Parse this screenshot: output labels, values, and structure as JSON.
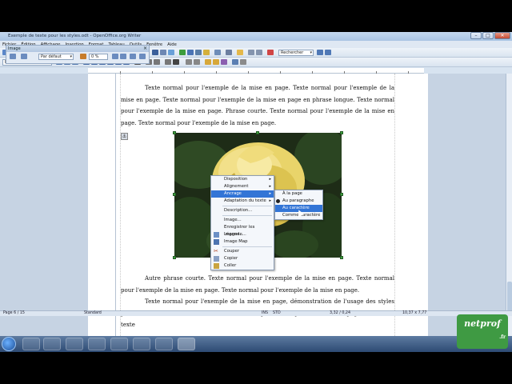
{
  "window": {
    "title": "Exemple de texte pour les styles.odt - OpenOffice.org Writer"
  },
  "menu": {
    "items": [
      "Fichier",
      "Édition",
      "Affichage",
      "Insertion",
      "Format",
      "Tableau",
      "Outils",
      "Fenêtre",
      "Aide"
    ]
  },
  "toolbar": {
    "search_placeholder": "Rechercher",
    "style_combo": "Images"
  },
  "image_panel": {
    "title": "Image",
    "preset": "Par défaut",
    "percent": "0 %"
  },
  "document": {
    "para1": "Texte normal pour l'exemple de la mise en page. Texte normal pour l'exemple de la mise en page. Texte normal pour l'exemple de la mise en page en phrase longue. Texte normal pour l'exemple de la mise en page. Phrase courte. Texte normal pour l'exemple de la mise en page. Texte normal pour l'exemple de la mise en page.",
    "para2": "Autre phrase courte. Texte normal pour l'exemple de la mise en page. Texte normal pour l'exemple de la mise en page. Texte normal pour l'exemple de la mise en page.",
    "para3": "Texte normal pour l'exemple de la mise en page, démonstration de l'usage des styles pour créer une table de matières. Texte normal pour l'exemple de la mise en page. Encore du texte"
  },
  "context_menu": {
    "items": [
      {
        "label": "Disposition",
        "submenu": true
      },
      {
        "label": "Alignement",
        "submenu": true
      },
      {
        "label": "Ancrage",
        "submenu": true,
        "highlighted": true
      },
      {
        "label": "Adaptation du texte",
        "submenu": true
      },
      {
        "sep": true
      },
      {
        "label": "Description..."
      },
      {
        "sep": true
      },
      {
        "label": "Image..."
      },
      {
        "label": "Enregistrer les images..."
      },
      {
        "label": "Légende...",
        "icon": "caption-icon"
      },
      {
        "label": "Image Map",
        "icon": "image-map-icon"
      },
      {
        "sep": true
      },
      {
        "label": "Couper",
        "icon": "scissors-icon"
      },
      {
        "label": "Copier",
        "icon": "copy-icon"
      },
      {
        "label": "Coller",
        "icon": "paste-icon"
      }
    ]
  },
  "submenu": {
    "items": [
      {
        "label": "À la page"
      },
      {
        "label": "Au paragraphe",
        "selected": true
      },
      {
        "label": "Au caractère",
        "highlighted": true
      },
      {
        "label": "Comme caractère"
      }
    ]
  },
  "statusbar": {
    "page": "Page 6 / 15",
    "style": "Standard",
    "mode": "INS",
    "selection": "STD",
    "pos": "3,32 / 0,24",
    "size": "10,37 x 7,77"
  },
  "logo": {
    "text": "netprof",
    "suffix": ".fr"
  }
}
